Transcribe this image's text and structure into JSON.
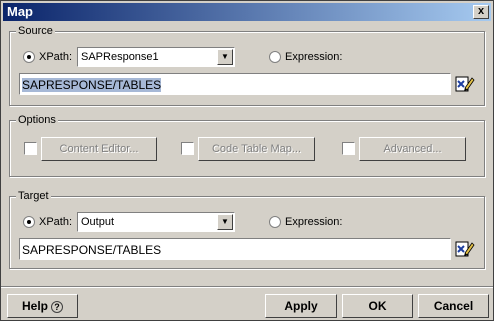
{
  "window": {
    "title": "Map",
    "close_label": "x"
  },
  "source": {
    "group_label": "Source",
    "xpath_label": "XPath:",
    "xpath_value": "SAPResponse1",
    "expression_label": "Expression:",
    "text_value": "SAPRESPONSE/TABLES"
  },
  "options": {
    "group_label": "Options",
    "content_editor_label": "Content Editor...",
    "code_table_map_label": "Code Table Map...",
    "advanced_label": "Advanced..."
  },
  "target": {
    "group_label": "Target",
    "xpath_label": "XPath:",
    "xpath_value": "Output",
    "expression_label": "Expression:",
    "text_value": "SAPRESPONSE/TABLES"
  },
  "footer": {
    "help_label": "Help",
    "help_icon_glyph": "?",
    "apply_label": "Apply",
    "ok_label": "OK",
    "cancel_label": "Cancel"
  }
}
